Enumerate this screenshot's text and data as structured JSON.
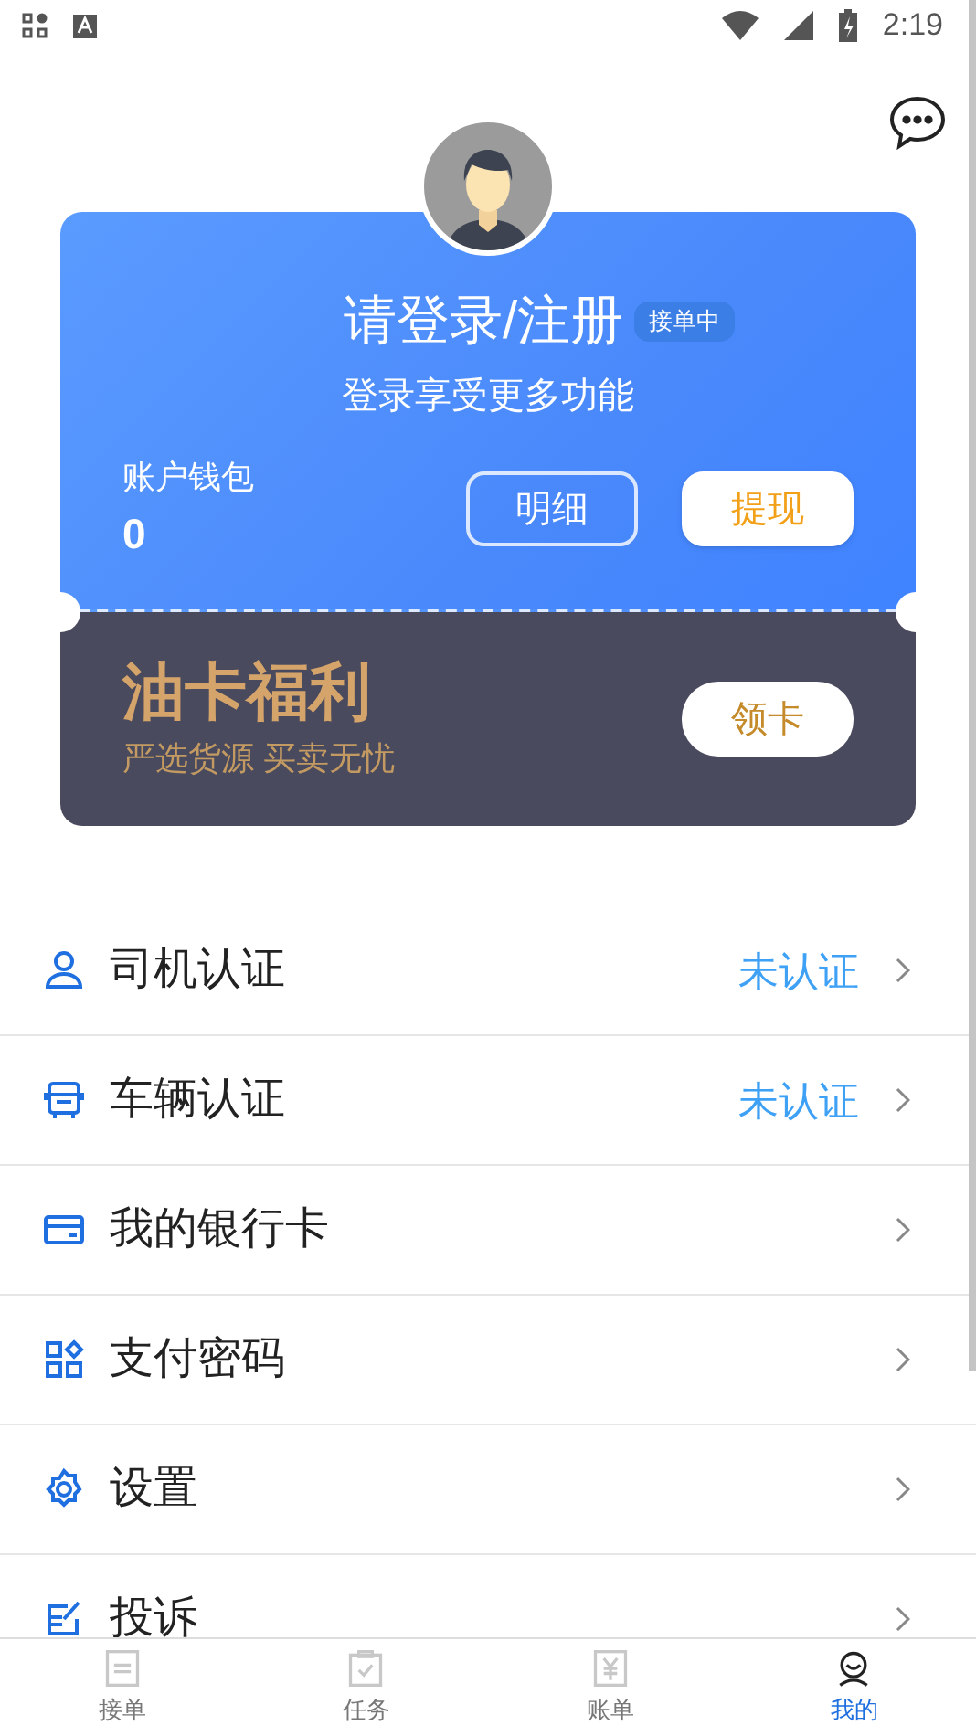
{
  "status_bar": {
    "time": "2:19"
  },
  "profile": {
    "title": "请登录/注册",
    "badge": "接单中",
    "subtitle": "登录享受更多功能"
  },
  "wallet": {
    "label": "账户钱包",
    "balance": "0",
    "buttons": [
      {
        "label": "明细",
        "kind": "outline"
      },
      {
        "label": "提现",
        "kind": "solid"
      }
    ]
  },
  "promo": {
    "title": "油卡福利",
    "subtitle": "严选货源 买卖无忧",
    "button": "领卡"
  },
  "menu": [
    {
      "kind": "person",
      "label": "司机认证",
      "status": "未认证"
    },
    {
      "kind": "vehicle",
      "label": "车辆认证",
      "status": "未认证"
    },
    {
      "kind": "card",
      "label": "我的银行卡"
    },
    {
      "kind": "grid",
      "label": "支付密码"
    },
    {
      "kind": "gear",
      "label": "设置"
    },
    {
      "kind": "edit",
      "label": "投诉"
    }
  ],
  "tabs": [
    {
      "label": "接单",
      "kind": "list",
      "selected": false
    },
    {
      "label": "任务",
      "kind": "clipboard",
      "selected": false
    },
    {
      "label": "账单",
      "kind": "bill",
      "selected": false
    },
    {
      "label": "我的",
      "kind": "user",
      "selected": true
    }
  ]
}
